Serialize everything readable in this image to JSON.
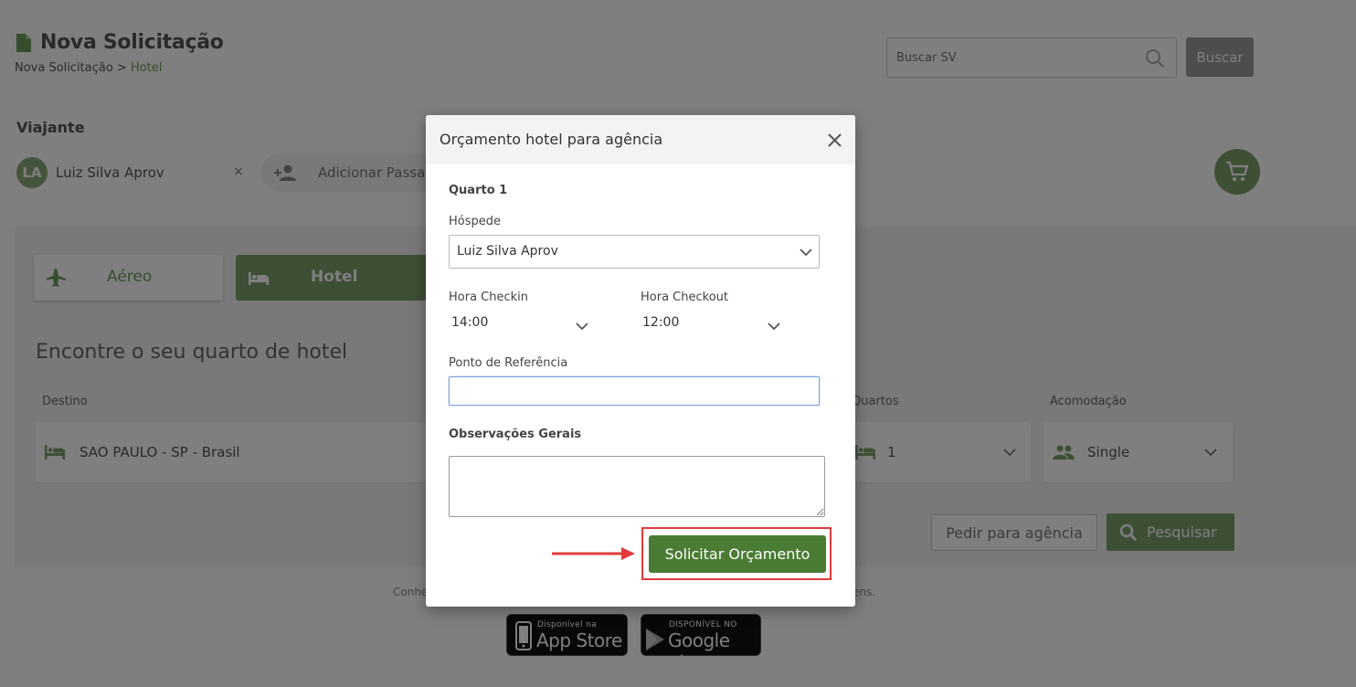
{
  "page": {
    "title": "Nova Solicitação",
    "breadcrumb_parent": "Nova Solicitação",
    "breadcrumb_sep": " > ",
    "breadcrumb_current": "Hotel"
  },
  "search": {
    "placeholder": "Buscar SV",
    "button_label": "Buscar"
  },
  "traveler": {
    "section_label": "Viajante",
    "initials": "LA",
    "name": "Luiz Silva Aprov",
    "remove_symbol": "×",
    "add_label": "Adicionar Passag"
  },
  "tabs": [
    {
      "label": "Aéreo",
      "icon": "airplane-icon",
      "active": false
    },
    {
      "label": "Hotel",
      "icon": "bed-icon",
      "active": true
    }
  ],
  "hotel_search": {
    "heading": "Encontre o seu quarto de hotel",
    "destino_label": "Destino",
    "destino_value": "SAO PAULO - SP - Brasil",
    "quartos_label": "Quartos",
    "quartos_value": "1",
    "acomodacao_label": "Acomodação",
    "acomodacao_value": "Single",
    "pedir_label": "Pedir para agência",
    "pesquisar_label": "Pesquisar"
  },
  "footer": {
    "text_left": "Conhe",
    "text_right": "ens.",
    "app_store_small": "Disponível na",
    "app_store_big": "App Store",
    "google_small": "DISPONÍVEL NO",
    "google_big": "Google play"
  },
  "modal": {
    "title": "Orçamento hotel para agência",
    "room_label": "Quarto 1",
    "guest_label": "Hóspede",
    "guest_value": "Luiz Silva Aprov",
    "checkin_label": "Hora Checkin",
    "checkin_value": "14:00",
    "checkout_label": "Hora Checkout",
    "checkout_value": "12:00",
    "reference_label": "Ponto de Referência",
    "reference_value": "",
    "notes_label": "Observações Gerais",
    "notes_value": "",
    "submit_label": "Solicitar Orçamento"
  },
  "colors": {
    "brand_green": "#7aa06a",
    "submit_green": "#4a7c34",
    "highlight_red": "#e23b3b",
    "focus_blue": "#7f9fe0"
  }
}
